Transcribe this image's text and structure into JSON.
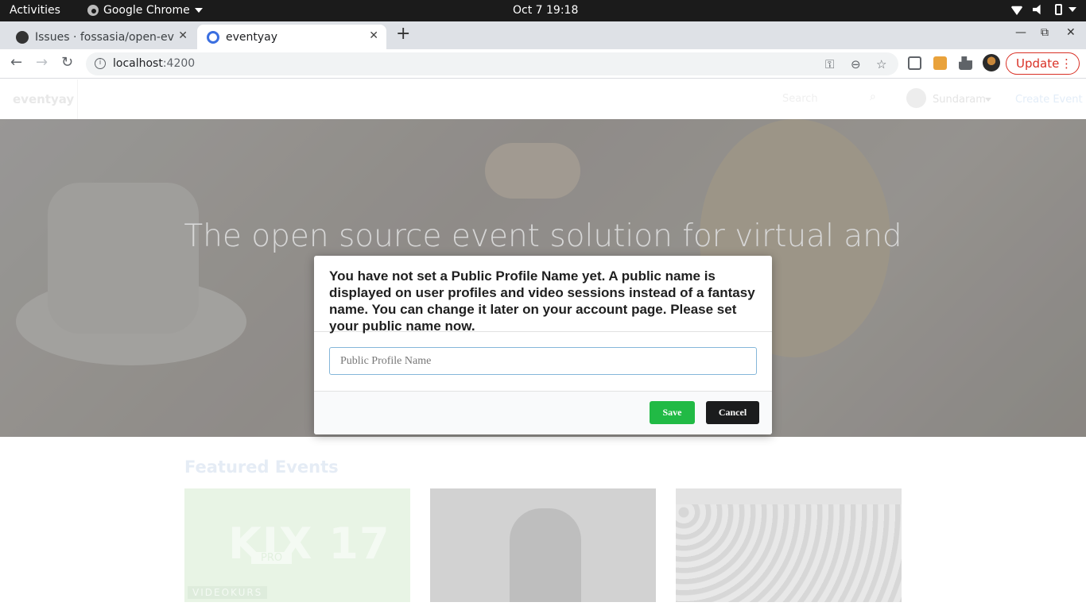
{
  "os": {
    "activities": "Activities",
    "app_name": "Google Chrome",
    "clock": "Oct 7  19:18"
  },
  "browser": {
    "tabs": [
      {
        "title": "Issues · fossasia/open-event-frontend",
        "active": false
      },
      {
        "title": "eventyay",
        "active": true
      }
    ],
    "url_host": "localhost",
    "url_port": ":4200",
    "update_label": "Update"
  },
  "site": {
    "brand": "eventyay",
    "search_placeholder": "Search",
    "user_name": "Sundaram",
    "create_event": "Create Event",
    "hero_title": "The open source event solution for virtual and",
    "featured_heading": "Featured Events",
    "cards": [
      {
        "kix": "KIX 17",
        "pro": "PRO",
        "tag": "VIDEOKURS"
      },
      {},
      {}
    ]
  },
  "modal": {
    "message": "You have not set a Public Profile Name yet. A public name is displayed on user profiles and video sessions instead of a fantasy name. You can change it later on your account page. Please set your public name now.",
    "input_placeholder": "Public Profile Name",
    "input_value": "",
    "save_label": "Save",
    "cancel_label": "Cancel"
  },
  "colors": {
    "save_green": "#21ba45",
    "cancel_black": "#1b1c1d",
    "update_red": "#d93025"
  }
}
